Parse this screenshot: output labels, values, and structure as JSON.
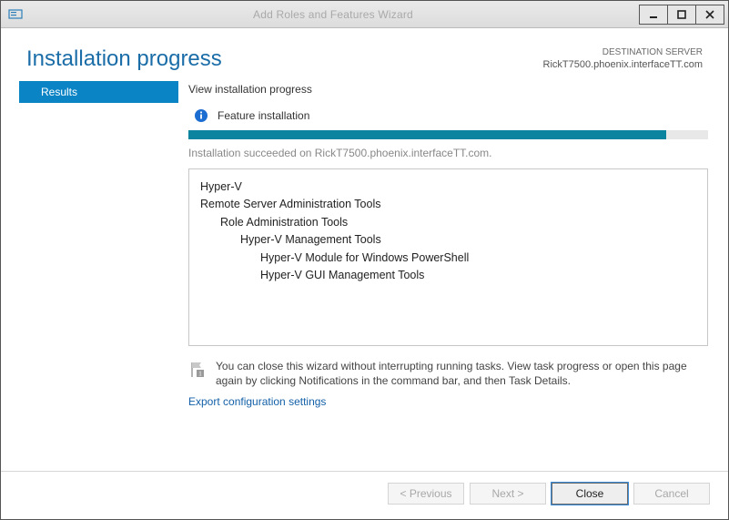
{
  "window": {
    "title": "Add Roles and Features Wizard"
  },
  "header": {
    "page_title": "Installation progress",
    "destination_label": "DESTINATION SERVER",
    "destination_server": "RickT7500.phoenix.interfaceTT.com"
  },
  "sidebar": {
    "items": [
      {
        "label": "Results"
      }
    ]
  },
  "main": {
    "view_label": "View installation progress",
    "feature_label": "Feature installation",
    "status_text": "Installation succeeded on RickT7500.phoenix.interfaceTT.com.",
    "progress_percent": 92,
    "tree": {
      "l0": "Hyper-V",
      "l0b": "Remote Server Administration Tools",
      "l1": "Role Administration Tools",
      "l2": "Hyper-V Management Tools",
      "l3a": "Hyper-V Module for Windows PowerShell",
      "l3b": "Hyper-V GUI Management Tools"
    },
    "notice_text": "You can close this wizard without interrupting running tasks. View task progress or open this page again by clicking Notifications in the command bar, and then Task Details.",
    "export_link": "Export configuration settings"
  },
  "footer": {
    "previous": "< Previous",
    "next": "Next >",
    "close": "Close",
    "cancel": "Cancel"
  }
}
